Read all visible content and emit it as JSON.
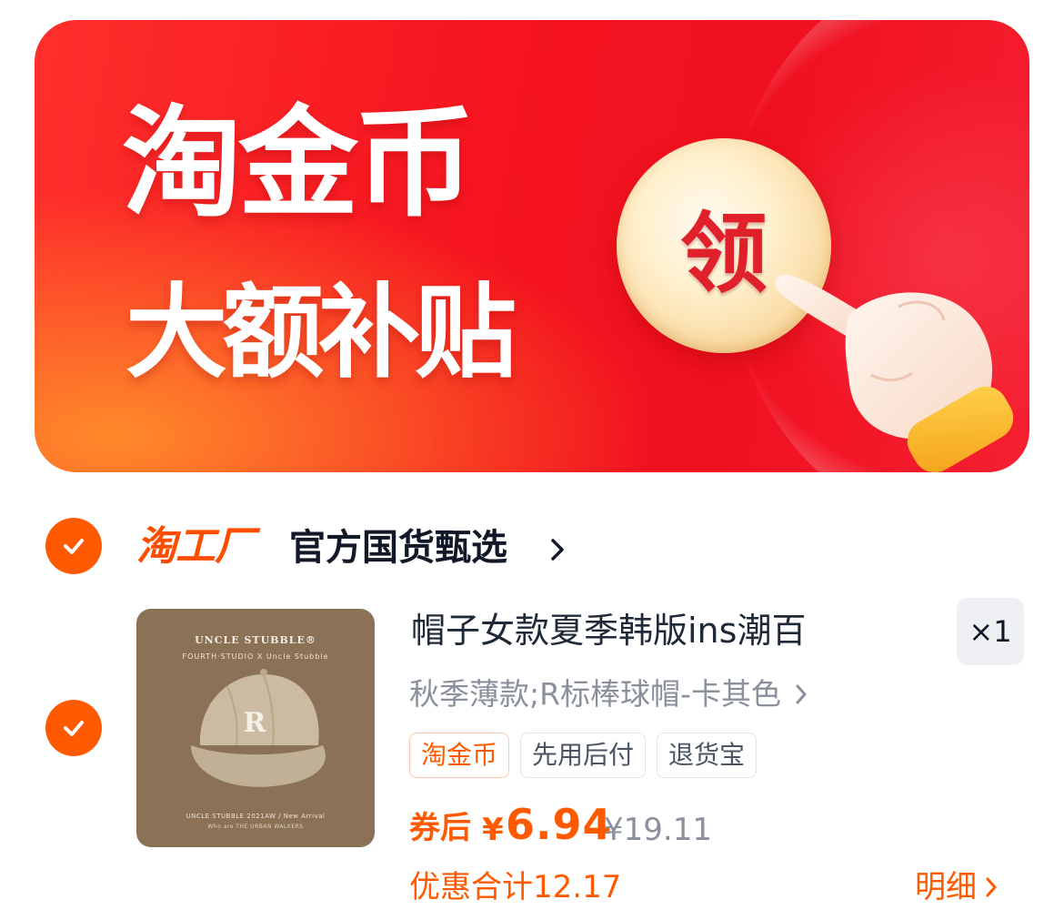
{
  "banner": {
    "title": "淘金币",
    "subtitle": "大额补贴",
    "claim_label": "领"
  },
  "shop": {
    "brand": "淘工厂",
    "name": "官方国货甄选"
  },
  "product": {
    "image_brand": "UNCLE STUBBLE®",
    "image_collab": "FOURTH·STUDIO  X  Uncle Stubble",
    "image_footer": "UNCLE STUBBLE 2021AW / New Arrival",
    "image_footer_2": "Who are THE URBAN WALKERS",
    "title": "帽子女款夏季韩版ins潮百",
    "quantity": "×1",
    "sku": "秋季薄款;R标棒球帽-卡其色",
    "tags": [
      "淘金币",
      "先用后付",
      "退货宝"
    ],
    "price_label": "券后",
    "currency": "¥",
    "price": "6.94",
    "original_price": "¥19.11",
    "discount_total": "优惠合计12.17",
    "details_label": "明细"
  },
  "colors": {
    "accent": "#ff5a00",
    "banner_red": "#f5141f",
    "muted_text": "#8a909c"
  }
}
